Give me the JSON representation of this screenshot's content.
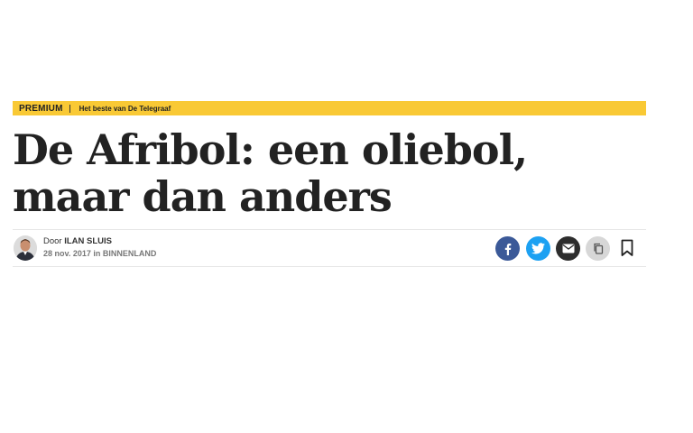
{
  "banner": {
    "label": "PREMIUM",
    "subtitle": "Het beste van De Telegraaf",
    "color": "#f9c935"
  },
  "article": {
    "headline": "De Afribol: een oliebol, maar dan anders",
    "byline_prefix": "Door",
    "author": "ILAN SLUIS",
    "meta": "28 nov. 2017 in BINNENLAND"
  },
  "share": {
    "items": [
      "facebook-icon",
      "twitter-icon",
      "email-icon",
      "copy-icon",
      "bookmark-icon"
    ],
    "colors": {
      "facebook": "#3b5998",
      "twitter": "#1da1f2",
      "email": "#2d2d2d",
      "copy": "#d7d7d7"
    }
  }
}
